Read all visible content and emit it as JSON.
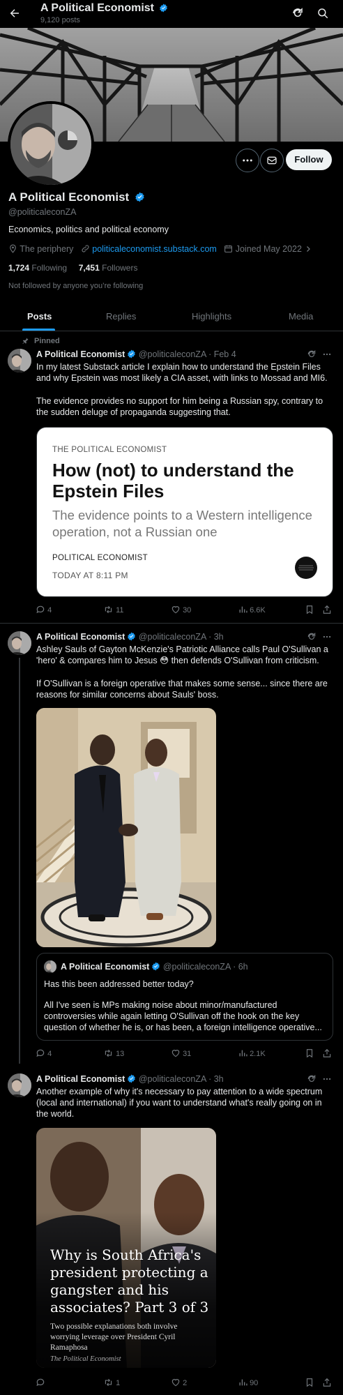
{
  "header": {
    "title": "A Political Economist",
    "post_count": "9,120 posts"
  },
  "profile": {
    "name": "A Political Economist",
    "handle": "@politicaleconZA",
    "bio": "Economics, politics and political economy",
    "location": "The periphery",
    "website": "politicaleconomist.substack.com",
    "joined": "Joined May 2022",
    "following_count": "1,724",
    "following_label": "Following",
    "followers_count": "7,451",
    "followers_label": "Followers",
    "not_followed": "Not followed by anyone you’re following",
    "follow_label": "Follow"
  },
  "tabs": [
    "Posts",
    "Replies",
    "Highlights",
    "Media"
  ],
  "posts": [
    {
      "pinned_label": "Pinned",
      "name": "A Political Economist",
      "handle_time": "@politicaleconZA · Feb 4",
      "text1": "In my latest Substack article I explain how to understand the Epstein Files and why Epstein was most likely a CIA asset, with links to Mossad and MI6.",
      "text2": "The evidence provides no support for him being a Russian spy, contrary to the sudden deluge of propaganda suggesting that.",
      "card": {
        "kicker": "THE POLITICAL ECONOMIST",
        "title": "How (not) to understand the Epstein Files",
        "subtitle": "The evidence points to a Western intelligence operation, not a Russian one",
        "publication": "POLITICAL ECONOMIST",
        "time": "TODAY AT 8:11 PM"
      },
      "replies": "4",
      "reposts": "11",
      "likes": "30",
      "views": "6.6K"
    },
    {
      "name": "A Political Economist",
      "handle_time": "@politicaleconZA · 3h",
      "text1": "Ashley Sauls of Gayton McKenzie's Patriotic Alliance calls Paul O'Sullivan a 'hero' & compares him to Jesus 😳 then defends O'Sullivan from criticism.",
      "text2": "If O'Sullivan is a foreign operative that makes some sense... since there are reasons for similar concerns about Sauls' boss.",
      "quote": {
        "name": "A Political Economist",
        "handle_time": "@politicaleconZA · 6h",
        "text1": "Has this been addressed better today?",
        "text2": "All I've seen is MPs making noise about minor/manufactured controversies while again letting O'Sullivan off the hook on the key question of whether he is, or has been, a foreign intelligence operative..."
      },
      "replies": "4",
      "reposts": "13",
      "likes": "31",
      "views": "2.1K"
    },
    {
      "name": "A Political Economist",
      "handle_time": "@politicaleconZA · 3h",
      "text1": "Another example of why it's necessary to pay attention to a wide spectrum (local and international) if you want to understand what's really going on in the world.",
      "image_card": {
        "title": "Why is South Africa's president protecting a gangster and his associates? Part 3 of 3",
        "subtitle": "Two possible explanations both involve worrying leverage over President Cyril Ramaphosa",
        "footer": "The Political Economist"
      },
      "replies": "",
      "reposts": "1",
      "likes": "2",
      "views": "90"
    }
  ],
  "colors": {
    "background": "#000000",
    "text": "#e7e9ea",
    "muted": "#71767b",
    "accent": "#1d9bf0",
    "border": "#2f3336"
  },
  "icons": [
    "back-arrow-icon",
    "verified-badge-icon",
    "grok-icon",
    "search-icon",
    "more-icon",
    "message-icon",
    "location-icon",
    "link-icon",
    "calendar-icon",
    "chevron-right-icon",
    "pin-icon",
    "reply-icon",
    "repost-icon",
    "like-icon",
    "views-icon",
    "bookmark-icon",
    "share-icon"
  ]
}
